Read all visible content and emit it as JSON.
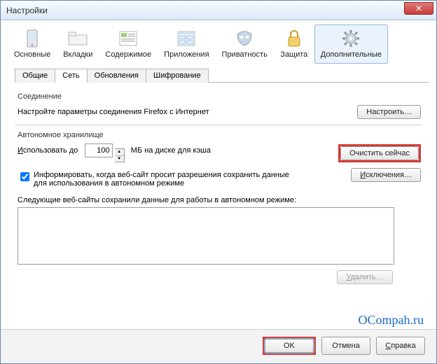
{
  "window": {
    "title": "Настройки"
  },
  "toolbar": [
    {
      "label": "Основные"
    },
    {
      "label": "Вкладки"
    },
    {
      "label": "Содержимое"
    },
    {
      "label": "Приложения"
    },
    {
      "label": "Приватность"
    },
    {
      "label": "Защита"
    },
    {
      "label": "Дополнительные"
    }
  ],
  "tabs": [
    {
      "label": "Общие"
    },
    {
      "label": "Сеть"
    },
    {
      "label": "Обновления"
    },
    {
      "label": "Шифрование"
    }
  ],
  "connection": {
    "group_label": "Соединение",
    "desc": "Настройте параметры соединения Firefox с Интернет",
    "configure_btn": "Настроить…"
  },
  "storage": {
    "group_label": "Автономное хранилище",
    "use_up_to_prefix": "Использовать до",
    "cache_value": "100",
    "use_up_to_suffix": "МБ на диске для кэша",
    "clear_now_btn": "Очистить сейчас",
    "inform_checkbox": "Информировать, когда веб-сайт просит разрешения сохранить данные для использования в автономном режиме",
    "exceptions_btn": "Исключения…",
    "saved_label": "Следующие веб-сайты сохранили данные для работы в автономном режиме:",
    "delete_btn": "Удалить…"
  },
  "footer": {
    "ok": "OK",
    "cancel": "Отмена",
    "help": "Справка"
  },
  "watermark": "OCompah.ru"
}
